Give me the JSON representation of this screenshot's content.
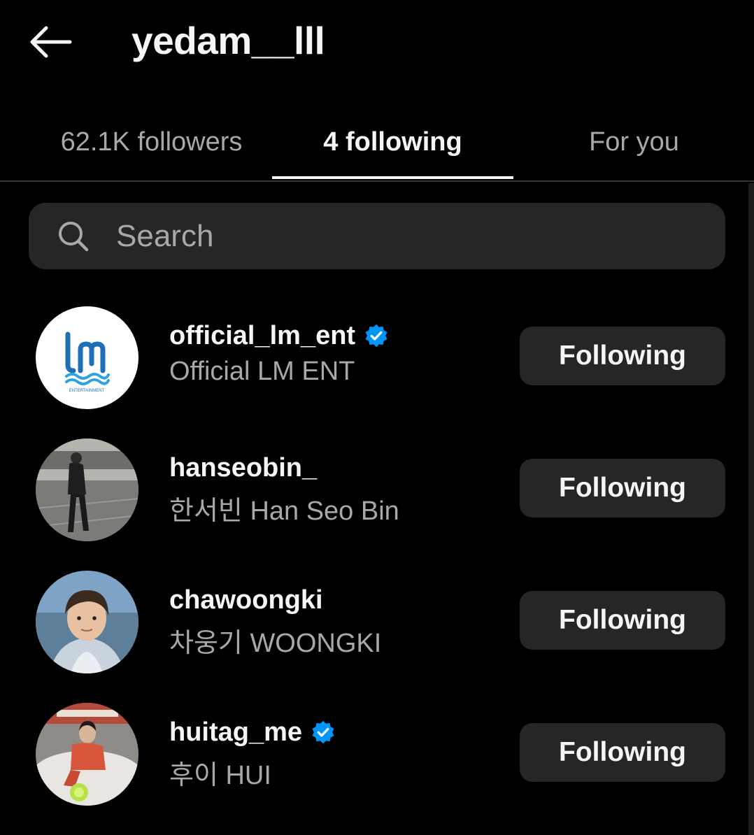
{
  "header": {
    "title": "yedam__lll",
    "back_icon": "arrow-left-icon"
  },
  "tabs": [
    {
      "label": "62.1K followers",
      "active": false
    },
    {
      "label": "4 following",
      "active": true
    },
    {
      "label": "For you",
      "active": false
    }
  ],
  "search": {
    "placeholder": "Search",
    "value": "",
    "icon": "search-icon"
  },
  "following": [
    {
      "username": "official_lm_ent",
      "full_name": "Official LM ENT",
      "verified": true,
      "button": "Following",
      "logo_text": "ENTERTAINMENT"
    },
    {
      "username": "hanseobin_",
      "full_name": "한서빈 Han Seo Bin",
      "verified": false,
      "button": "Following"
    },
    {
      "username": "chawoongki",
      "full_name": "차웅기 WOONGKI",
      "verified": false,
      "button": "Following"
    },
    {
      "username": "huitag_me",
      "full_name": "후이 HUI",
      "verified": true,
      "button": "Following"
    }
  ],
  "colors": {
    "background": "#000000",
    "surface": "#262626",
    "text_primary": "#f5f5f5",
    "text_secondary": "#a8a8a8",
    "verified_blue": "#0095f6",
    "divider": "#363636"
  }
}
